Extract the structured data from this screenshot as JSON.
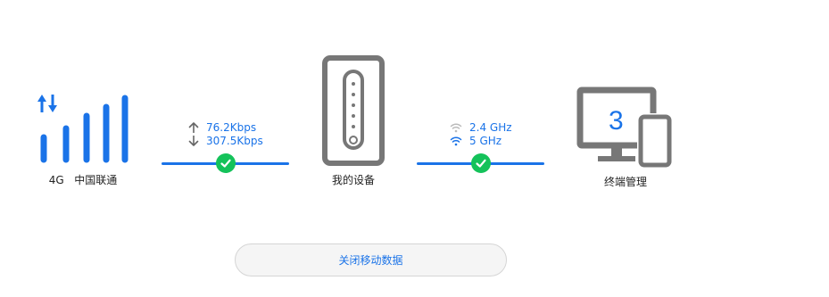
{
  "network": {
    "type": "4G",
    "carrier": "中国联通",
    "signal_bars": 4
  },
  "upstream": {
    "upload": "76.2Kbps",
    "download": "307.5Kbps"
  },
  "device": {
    "label": "我的设备"
  },
  "wifi": {
    "band_24": "2.4 GHz",
    "band_5": "5 GHz"
  },
  "terminals": {
    "count": "3",
    "label": "终端管理"
  },
  "actions": {
    "disable_mobile_data": "关闭移动数据"
  },
  "colors": {
    "accent": "#1a73e8",
    "ok": "#14c25a",
    "device_gray": "#777777"
  }
}
